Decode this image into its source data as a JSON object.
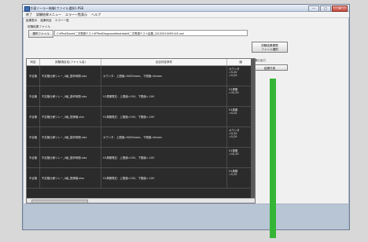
{
  "window": {
    "title": "冷凍ソーラー制御(ファイル選択)-PSB",
    "min": "—",
    "max": "□",
    "close": "✕"
  },
  "menu": [
    "終了",
    "試験結果メニュー",
    "エラー一覧表示",
    "ヘルプ"
  ],
  "subbar": [
    "結果表示",
    "結果判定",
    "エラー一覧"
  ],
  "group": {
    "label": "試験結果ファイル",
    "select_button": "選択ファイル",
    "path": "C:¥TestStore¥二次電源テスト¥PTestDiagnose¥testdata¥二次電源テスト結果_20130510095145.xml"
  },
  "side": {
    "file_button_lines": [
      "試験結果履歴",
      "ファイル選択"
    ],
    "start_label": "結果の出力",
    "start_button": "結果作成"
  },
  "table": {
    "headers": [
      "判定",
      "試験項目名(ファイル名)",
      "合否判定条件",
      "値"
    ],
    "rows": [
      {
        "judge": "不合格",
        "item": "不定格仕様リレー_0組_動作時間.xlsx",
        "cond": "カウンタ：上限値=5000msec、下限値=0msec",
        "value": [
          "カウンタ",
          "=5,20",
          "=5,20"
        ]
      },
      {
        "judge": "不合格",
        "item": "不定格仕様リレー_0組_動作時間.xlsx",
        "cond": "V1周期電圧：上限値=10V、下限値=-10V",
        "value": [
          "V1周期",
          "=10,20"
        ]
      },
      {
        "judge": "不合格",
        "item": "不定格仕様リレー_0組_復帰値.xlsx",
        "cond": "V1周期電圧：上限値=10V、下限値=-10V",
        "value": [
          "V1周期",
          "=0,20"
        ]
      },
      {
        "judge": "不合格",
        "item": "不定格仕様リレー_0組_動作時間.xlsx",
        "cond": "カウンタ：上限値=5000msec、下限値=0msec",
        "value": [
          "カウンタ",
          "=5,20",
          "=5,20"
        ]
      },
      {
        "judge": "不合格",
        "item": "不定格仕様リレー_0組_動作時間.xlsx",
        "cond": "V1周期電圧：上限値=10V、下限値=-10V",
        "value": [
          "V1周期",
          "=10,20"
        ]
      },
      {
        "judge": "不合格",
        "item": "不定格仕様リレー_0組_復帰値.xlsx",
        "cond": "V1周期電圧：上限値=10V、下限値=-10V",
        "value": [
          "V1周期",
          "=0,20"
        ]
      }
    ]
  }
}
